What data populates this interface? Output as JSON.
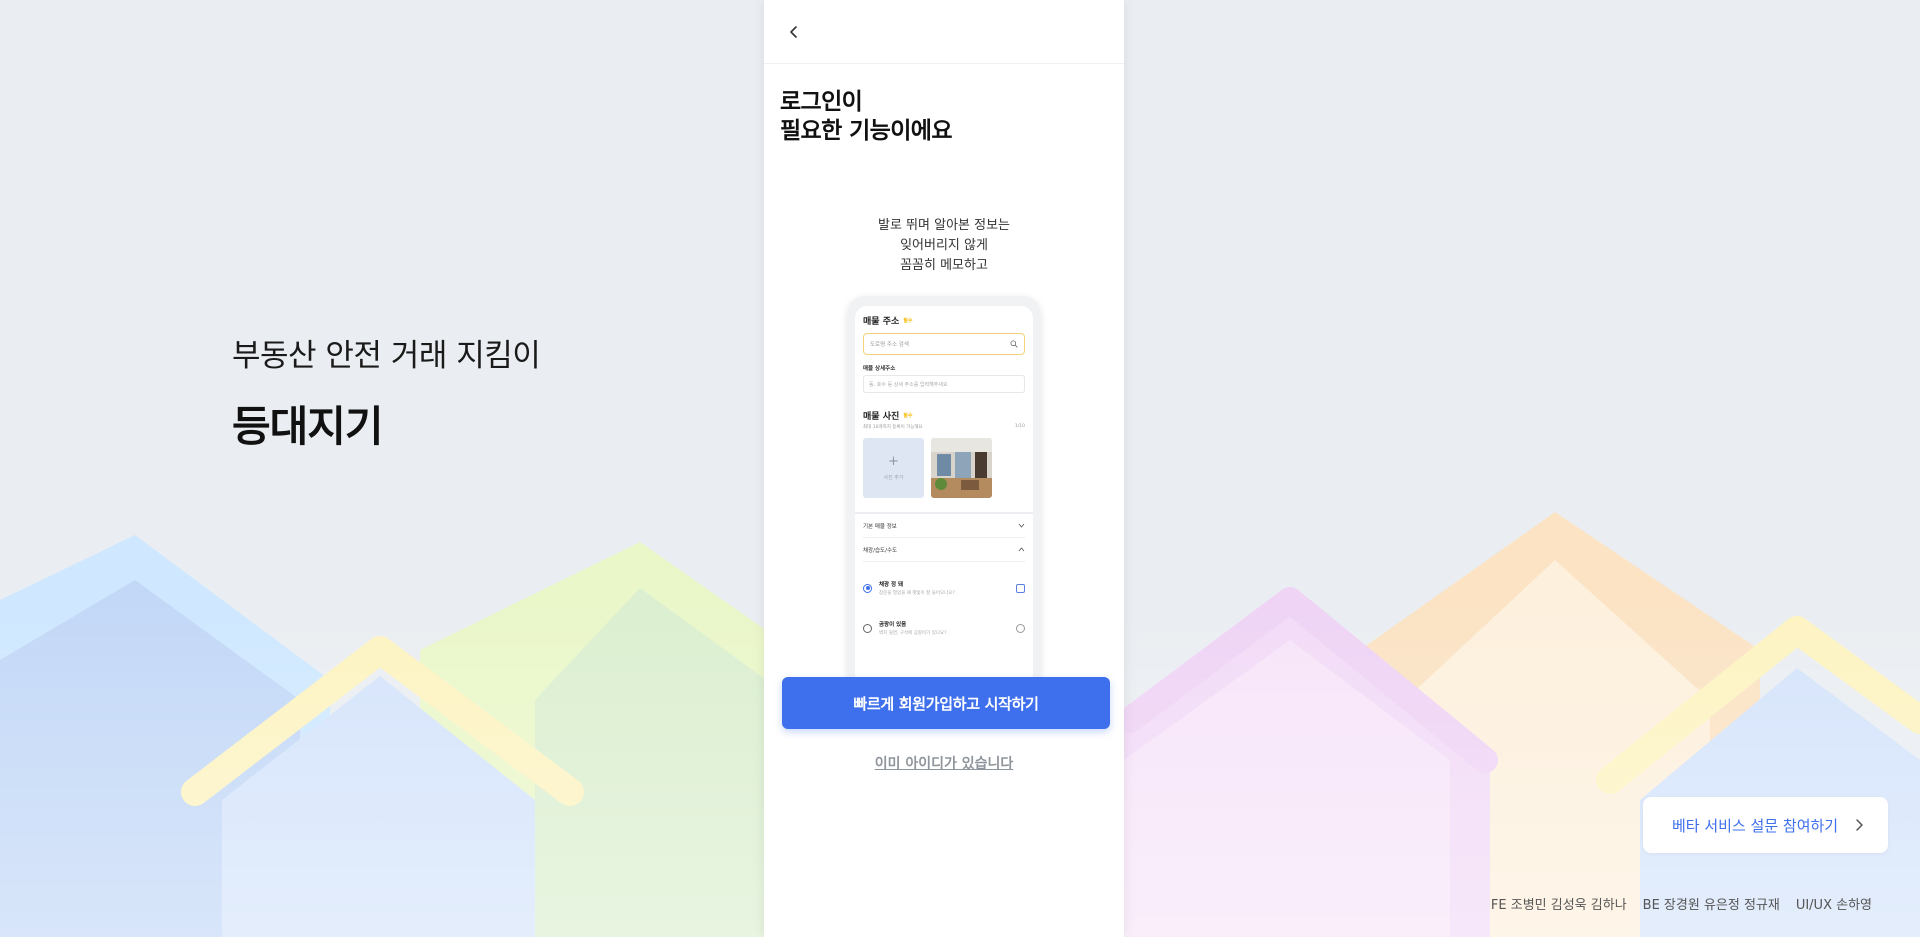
{
  "brand": {
    "tagline": "부동산 안전 거래 지킴이",
    "logo": "등대지기"
  },
  "panel": {
    "back_icon": "chevron-left-icon",
    "title_line1": "로그인이",
    "title_line2": "필요한 기능이에요",
    "desc_line1": "발로 뛰며 알아본 정보는",
    "desc_line2": "잊어버리지 않게",
    "desc_line3": "꼼꼼히 메모하고",
    "cta_label": "빠르게 회원가입하고 시작하기",
    "login_link": "이미 아이디가 있습니다"
  },
  "mockup": {
    "address_title": "매물 주소",
    "required": "필수",
    "search_placeholder": "도로명 주소 검색",
    "detail_label": "매물 상세주소",
    "detail_placeholder": "동, 호수 등 상세 주소를 입력해주세요",
    "photo_title": "매물 사진",
    "photo_hint": "최대 10개까지 등록이 가능해요",
    "photo_count": "1/10",
    "add_photo": "사진 추가",
    "accordion1": "기본 매물 정보",
    "accordion2": "채광/습도/수도",
    "item1_title": "채광 정 돼",
    "item1_desc": "창문을 열었을 때 햇빛이 잘 들어오나요?",
    "item2_title": "곰팡이 있음",
    "item2_desc": "벽지 뒷면, 구석에 곰팡이가 있나요?"
  },
  "survey": {
    "label": "베타 서비스 설문 참여하기",
    "icon": "chevron-right-icon"
  },
  "credits": {
    "fe": "FE 조병민 김성욱 김하나",
    "be": "BE 장경원 유은정 정규재",
    "design": "UI/UX 손하영"
  },
  "colors": {
    "accent": "#3e6fec",
    "background": "#eaeef2"
  }
}
